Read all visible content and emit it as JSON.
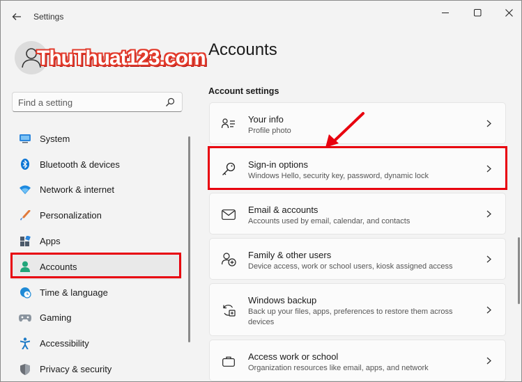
{
  "app": {
    "title": "Settings"
  },
  "watermark": {
    "text": "ThuThuat123.com"
  },
  "search": {
    "placeholder": "Find a setting"
  },
  "nav": {
    "items": [
      {
        "label": "System",
        "icon": "system-icon",
        "color": "#0a74d4"
      },
      {
        "label": "Bluetooth & devices",
        "icon": "bluetooth-icon",
        "color": "#0a74d4"
      },
      {
        "label": "Network & internet",
        "icon": "wifi-icon",
        "color": "#0a74d4"
      },
      {
        "label": "Personalization",
        "icon": "brush-icon",
        "color": "#e8834a"
      },
      {
        "label": "Apps",
        "icon": "apps-icon",
        "color": "#4c5a6b"
      },
      {
        "label": "Accounts",
        "icon": "accounts-icon",
        "color": "#21a57a",
        "active": true
      },
      {
        "label": "Time & language",
        "icon": "globe-clock-icon",
        "color": "#1f8ad6"
      },
      {
        "label": "Gaming",
        "icon": "gamepad-icon",
        "color": "#808a94"
      },
      {
        "label": "Accessibility",
        "icon": "accessibility-icon",
        "color": "#1e7bc6"
      },
      {
        "label": "Privacy & security",
        "icon": "shield-icon",
        "color": "#6b6f76"
      }
    ]
  },
  "main": {
    "title": "Accounts",
    "section_title": "Account settings",
    "cards": [
      {
        "title": "Your info",
        "subtitle": "Profile photo",
        "icon": "person-card-icon"
      },
      {
        "title": "Sign-in options",
        "subtitle": "Windows Hello, security key, password, dynamic lock",
        "icon": "key-icon"
      },
      {
        "title": "Email & accounts",
        "subtitle": "Accounts used by email, calendar, and contacts",
        "icon": "mail-icon"
      },
      {
        "title": "Family & other users",
        "subtitle": "Device access, work or school users, kiosk assigned access",
        "icon": "add-user-icon"
      },
      {
        "title": "Windows backup",
        "subtitle": "Back up your files, apps, preferences to restore them across devices",
        "icon": "backup-icon"
      },
      {
        "title": "Access work or school",
        "subtitle": "Organization resources like email, apps, and network",
        "icon": "briefcase-icon"
      }
    ]
  },
  "colors": {
    "highlight": "#e8000e",
    "accent": "#005fb8"
  }
}
